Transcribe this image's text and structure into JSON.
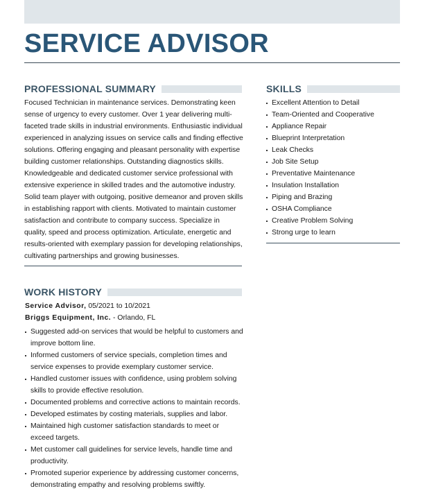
{
  "header": {
    "name": "SERVICE ADVISOR"
  },
  "summary": {
    "heading": "PROFESSIONAL SUMMARY",
    "text": "Focused Technician in maintenance services. Demonstrating keen sense of urgency to every customer. Over 1 year delivering multi-faceted trade skills in industrial environments. Enthusiastic individual experienced in analyzing issues on service calls and finding effective solutions. Offering engaging and pleasant personality with expertise building customer relationships. Outstanding diagnostics skills. Knowledgeable and dedicated customer service professional with extensive experience in skilled trades and the automotive industry. Solid team player with outgoing, positive demeanor and proven skills in establishing rapport with clients. Motivated to maintain customer satisfaction and contribute to company success. Specialize in quality, speed and process optimization. Articulate, energetic and results-oriented with exemplary passion for developing relationships, cultivating partnerships and growing businesses."
  },
  "skills": {
    "heading": "SKILLS",
    "items": [
      "Excellent Attention to Detail",
      "Team-Oriented and Cooperative",
      "Appliance Repair",
      "Blueprint Interpretation",
      "Leak Checks",
      "Job Site Setup",
      "Preventative Maintenance",
      "Insulation Installation",
      "Piping and Brazing",
      "OSHA Compliance",
      "Creative Problem Solving",
      "Strong urge to learn"
    ]
  },
  "work_history": {
    "heading": "WORK HISTORY",
    "jobs": [
      {
        "title": "Service Advisor,",
        "dates": " 05/2021 to 10/2021",
        "company": "Briggs Equipment, Inc.",
        "location": " - Orlando, FL",
        "duties": [
          "Suggested add-on services that would be helpful to customers and improve bottom line.",
          "Informed customers of service specials, completion times and service expenses to provide exemplary customer service.",
          "Handled customer issues with confidence, using problem solving skills to provide effective resolution.",
          "Documented problems and corrective actions to maintain records.",
          "Developed estimates by costing materials, supplies and labor.",
          "Maintained high customer satisfaction standards to meet or exceed targets.",
          "Met customer call guidelines for service levels, handle time and productivity.",
          "Promoted superior experience by addressing customer concerns, demonstrating empathy and resolving problems swiftly."
        ]
      }
    ]
  },
  "colors": {
    "name": "#2a5677",
    "section_heading": "#3b5566",
    "band": "#e0e6ea",
    "rule": "#3e5260"
  }
}
